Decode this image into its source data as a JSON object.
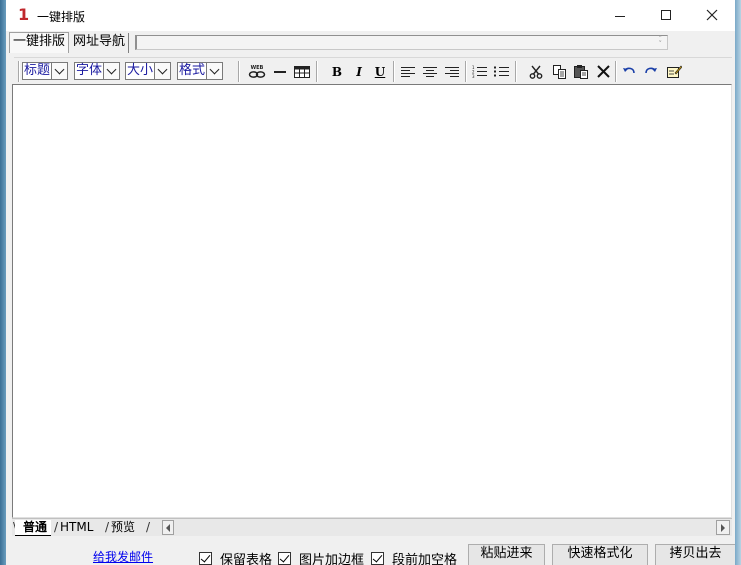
{
  "window": {
    "logo_text": "1",
    "title": "一键排版",
    "minimize_icon": "minimize-icon",
    "maximize_icon": "maximize-icon",
    "close_icon": "close-icon"
  },
  "tabs": [
    {
      "label": "一键排版",
      "active": true
    },
    {
      "label": "网址导航",
      "active": false
    }
  ],
  "address_bar": {
    "value": ""
  },
  "toolbar": {
    "selects": [
      {
        "label": "标题"
      },
      {
        "label": "字体"
      },
      {
        "label": "大小"
      },
      {
        "label": "格式"
      }
    ],
    "web_icon_text": "WEB",
    "bold_label": "B",
    "italic_label": "I",
    "underline_label": "U",
    "icons": [
      "web-link-icon",
      "horizontal-rule-icon",
      "table-icon",
      "bold-icon",
      "italic-icon",
      "underline-icon",
      "align-left-icon",
      "align-center-icon",
      "align-right-icon",
      "numbered-list-icon",
      "bullet-list-icon",
      "cut-icon",
      "copy-icon",
      "paste-icon",
      "delete-icon",
      "undo-icon",
      "redo-icon",
      "edit-note-icon"
    ]
  },
  "editor": {
    "content": ""
  },
  "bottom_tabs": [
    {
      "label": "普通",
      "active": true
    },
    {
      "label": "HTML",
      "active": false
    },
    {
      "label": "预览",
      "active": false
    }
  ],
  "footer": {
    "mail_link": "给我发邮件",
    "checkboxes": [
      {
        "label": "保留表格",
        "checked": true
      },
      {
        "label": "图片加边框",
        "checked": true
      },
      {
        "label": "段前加空格",
        "checked": true
      }
    ],
    "buttons": [
      {
        "label": "粘贴进来"
      },
      {
        "label": "快速格式化"
      },
      {
        "label": "拷贝出去"
      }
    ]
  },
  "colors": {
    "logo": "#c0282d",
    "select_text": "#1a1aa0",
    "link": "#0000ee"
  }
}
